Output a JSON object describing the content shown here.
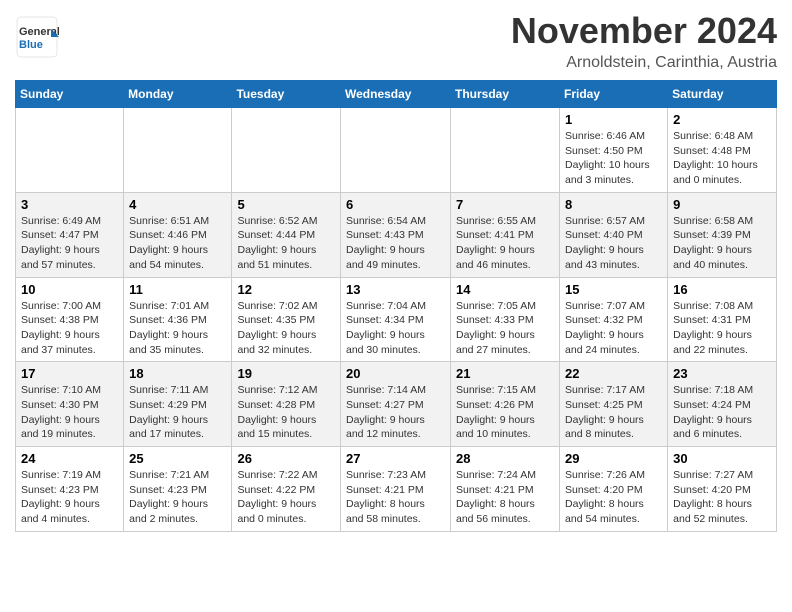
{
  "header": {
    "logo_line1": "General",
    "logo_line2": "Blue",
    "month_title": "November 2024",
    "location": "Arnoldstein, Carinthia, Austria"
  },
  "weekdays": [
    "Sunday",
    "Monday",
    "Tuesday",
    "Wednesday",
    "Thursday",
    "Friday",
    "Saturday"
  ],
  "weeks": [
    [
      {
        "day": "",
        "info": ""
      },
      {
        "day": "",
        "info": ""
      },
      {
        "day": "",
        "info": ""
      },
      {
        "day": "",
        "info": ""
      },
      {
        "day": "",
        "info": ""
      },
      {
        "day": "1",
        "info": "Sunrise: 6:46 AM\nSunset: 4:50 PM\nDaylight: 10 hours\nand 3 minutes."
      },
      {
        "day": "2",
        "info": "Sunrise: 6:48 AM\nSunset: 4:48 PM\nDaylight: 10 hours\nand 0 minutes."
      }
    ],
    [
      {
        "day": "3",
        "info": "Sunrise: 6:49 AM\nSunset: 4:47 PM\nDaylight: 9 hours\nand 57 minutes."
      },
      {
        "day": "4",
        "info": "Sunrise: 6:51 AM\nSunset: 4:46 PM\nDaylight: 9 hours\nand 54 minutes."
      },
      {
        "day": "5",
        "info": "Sunrise: 6:52 AM\nSunset: 4:44 PM\nDaylight: 9 hours\nand 51 minutes."
      },
      {
        "day": "6",
        "info": "Sunrise: 6:54 AM\nSunset: 4:43 PM\nDaylight: 9 hours\nand 49 minutes."
      },
      {
        "day": "7",
        "info": "Sunrise: 6:55 AM\nSunset: 4:41 PM\nDaylight: 9 hours\nand 46 minutes."
      },
      {
        "day": "8",
        "info": "Sunrise: 6:57 AM\nSunset: 4:40 PM\nDaylight: 9 hours\nand 43 minutes."
      },
      {
        "day": "9",
        "info": "Sunrise: 6:58 AM\nSunset: 4:39 PM\nDaylight: 9 hours\nand 40 minutes."
      }
    ],
    [
      {
        "day": "10",
        "info": "Sunrise: 7:00 AM\nSunset: 4:38 PM\nDaylight: 9 hours\nand 37 minutes."
      },
      {
        "day": "11",
        "info": "Sunrise: 7:01 AM\nSunset: 4:36 PM\nDaylight: 9 hours\nand 35 minutes."
      },
      {
        "day": "12",
        "info": "Sunrise: 7:02 AM\nSunset: 4:35 PM\nDaylight: 9 hours\nand 32 minutes."
      },
      {
        "day": "13",
        "info": "Sunrise: 7:04 AM\nSunset: 4:34 PM\nDaylight: 9 hours\nand 30 minutes."
      },
      {
        "day": "14",
        "info": "Sunrise: 7:05 AM\nSunset: 4:33 PM\nDaylight: 9 hours\nand 27 minutes."
      },
      {
        "day": "15",
        "info": "Sunrise: 7:07 AM\nSunset: 4:32 PM\nDaylight: 9 hours\nand 24 minutes."
      },
      {
        "day": "16",
        "info": "Sunrise: 7:08 AM\nSunset: 4:31 PM\nDaylight: 9 hours\nand 22 minutes."
      }
    ],
    [
      {
        "day": "17",
        "info": "Sunrise: 7:10 AM\nSunset: 4:30 PM\nDaylight: 9 hours\nand 19 minutes."
      },
      {
        "day": "18",
        "info": "Sunrise: 7:11 AM\nSunset: 4:29 PM\nDaylight: 9 hours\nand 17 minutes."
      },
      {
        "day": "19",
        "info": "Sunrise: 7:12 AM\nSunset: 4:28 PM\nDaylight: 9 hours\nand 15 minutes."
      },
      {
        "day": "20",
        "info": "Sunrise: 7:14 AM\nSunset: 4:27 PM\nDaylight: 9 hours\nand 12 minutes."
      },
      {
        "day": "21",
        "info": "Sunrise: 7:15 AM\nSunset: 4:26 PM\nDaylight: 9 hours\nand 10 minutes."
      },
      {
        "day": "22",
        "info": "Sunrise: 7:17 AM\nSunset: 4:25 PM\nDaylight: 9 hours\nand 8 minutes."
      },
      {
        "day": "23",
        "info": "Sunrise: 7:18 AM\nSunset: 4:24 PM\nDaylight: 9 hours\nand 6 minutes."
      }
    ],
    [
      {
        "day": "24",
        "info": "Sunrise: 7:19 AM\nSunset: 4:23 PM\nDaylight: 9 hours\nand 4 minutes."
      },
      {
        "day": "25",
        "info": "Sunrise: 7:21 AM\nSunset: 4:23 PM\nDaylight: 9 hours\nand 2 minutes."
      },
      {
        "day": "26",
        "info": "Sunrise: 7:22 AM\nSunset: 4:22 PM\nDaylight: 9 hours\nand 0 minutes."
      },
      {
        "day": "27",
        "info": "Sunrise: 7:23 AM\nSunset: 4:21 PM\nDaylight: 8 hours\nand 58 minutes."
      },
      {
        "day": "28",
        "info": "Sunrise: 7:24 AM\nSunset: 4:21 PM\nDaylight: 8 hours\nand 56 minutes."
      },
      {
        "day": "29",
        "info": "Sunrise: 7:26 AM\nSunset: 4:20 PM\nDaylight: 8 hours\nand 54 minutes."
      },
      {
        "day": "30",
        "info": "Sunrise: 7:27 AM\nSunset: 4:20 PM\nDaylight: 8 hours\nand 52 minutes."
      }
    ]
  ]
}
